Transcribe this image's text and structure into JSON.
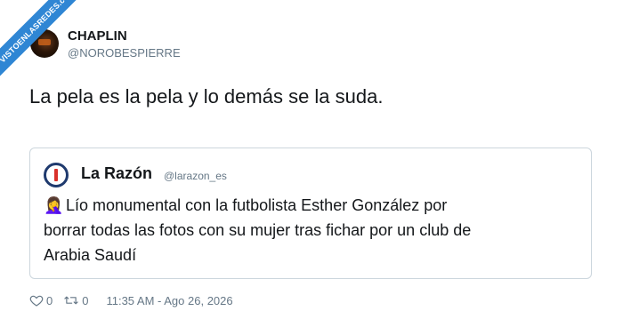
{
  "watermark": {
    "text": "VISTOENLASREDES.com"
  },
  "author": {
    "name": "CHAPLIN",
    "handle": "@NOROBESPIERRE"
  },
  "tweet": {
    "text": "La pela es la pela y lo demás se la suda."
  },
  "quoted": {
    "name": "La Razón",
    "handle": "@larazon_es",
    "emoji": "🤦‍♀️",
    "lines": [
      "Lío monumental con la futbolista Esther González por",
      "borrar todas las fotos con su mujer tras fichar por un club de",
      "Arabia Saudí"
    ]
  },
  "stats": {
    "likes": "0",
    "retweets": "0",
    "timestamp": "11:35 AM - Ago 26, 2026"
  },
  "colors": {
    "ribbon": "#2f86d4",
    "muted": "#657786",
    "border": "#ccd6dd",
    "text": "#14171a"
  },
  "icons": [
    "heart-icon",
    "retweet-icon"
  ]
}
